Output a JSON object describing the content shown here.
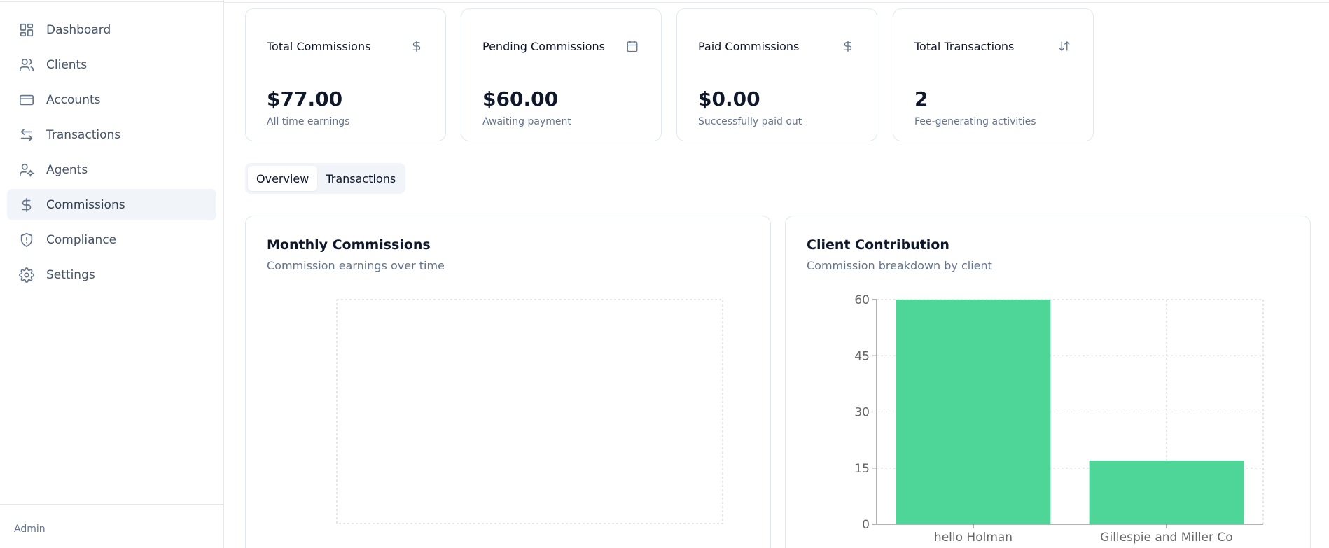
{
  "sidebar": {
    "items": [
      {
        "label": "Dashboard",
        "icon": "dashboard-icon"
      },
      {
        "label": "Clients",
        "icon": "users-icon"
      },
      {
        "label": "Accounts",
        "icon": "credit-card-icon"
      },
      {
        "label": "Transactions",
        "icon": "arrows-icon"
      },
      {
        "label": "Agents",
        "icon": "user-cog-icon"
      },
      {
        "label": "Commissions",
        "icon": "dollar-icon",
        "active": true
      },
      {
        "label": "Compliance",
        "icon": "shield-icon"
      },
      {
        "label": "Settings",
        "icon": "gear-icon"
      }
    ],
    "footer": "Admin"
  },
  "stats": [
    {
      "title": "Total Commissions",
      "value": "$77.00",
      "sub": "All time earnings",
      "icon": "dollar-icon"
    },
    {
      "title": "Pending Commissions",
      "value": "$60.00",
      "sub": "Awaiting payment",
      "icon": "calendar-icon"
    },
    {
      "title": "Paid Commissions",
      "value": "$0.00",
      "sub": "Successfully paid out",
      "icon": "dollar-icon"
    },
    {
      "title": "Total Transactions",
      "value": "2",
      "sub": "Fee-generating activities",
      "icon": "sort-arrows-icon"
    }
  ],
  "tabs": [
    {
      "label": "Overview",
      "active": true
    },
    {
      "label": "Transactions",
      "active": false
    }
  ],
  "monthly": {
    "title": "Monthly Commissions",
    "subtitle": "Commission earnings over time"
  },
  "contribution": {
    "title": "Client Contribution",
    "subtitle": "Commission breakdown by client"
  },
  "chart_data": [
    {
      "type": "line",
      "title": "Monthly Commissions",
      "subtitle": "Commission earnings over time",
      "series": [],
      "grid": true
    },
    {
      "type": "bar",
      "title": "Client Contribution",
      "subtitle": "Commission breakdown by client",
      "categories": [
        "hello Holman",
        "Gillespie and Miller Co"
      ],
      "values": [
        60,
        17
      ],
      "yticks": [
        0,
        15,
        30,
        45,
        60
      ],
      "ylim": [
        0,
        60
      ],
      "grid": true,
      "color": "#4ed699"
    }
  ],
  "colors": {
    "accent_bar": "#4ed699",
    "active_nav_bg": "#f1f5f9",
    "muted_text": "#64748b"
  }
}
